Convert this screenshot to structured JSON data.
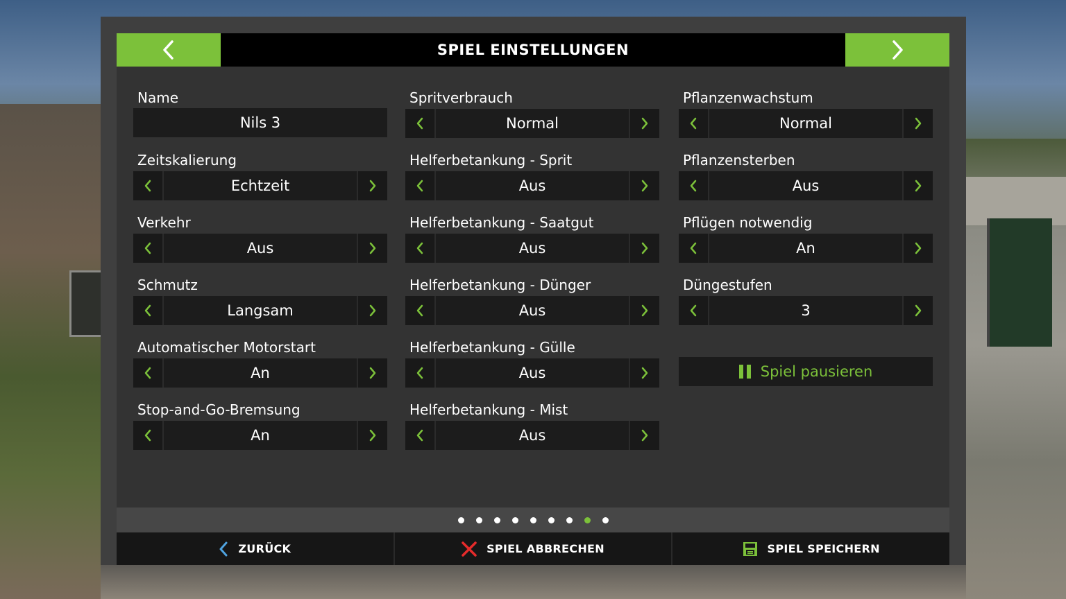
{
  "colors": {
    "accent": "#7cc13a",
    "cancel_red": "#e52b2b",
    "back_blue": "#4fa3e0"
  },
  "header": {
    "title": "SPIEL EINSTELLUNGEN",
    "prev_icon": "chevron-left-icon",
    "next_icon": "chevron-right-icon"
  },
  "settings": {
    "col1": [
      {
        "label": "Name",
        "value": "Nils 3",
        "type": "text"
      },
      {
        "label": "Zeitskalierung",
        "value": "Echtzeit"
      },
      {
        "label": "Verkehr",
        "value": "Aus"
      },
      {
        "label": "Schmutz",
        "value": "Langsam"
      },
      {
        "label": "Automatischer Motorstart",
        "value": "An"
      },
      {
        "label": "Stop-and-Go-Bremsung",
        "value": "An"
      }
    ],
    "col2": [
      {
        "label": "Spritverbrauch",
        "value": "Normal"
      },
      {
        "label": "Helferbetankung - Sprit",
        "value": "Aus"
      },
      {
        "label": "Helferbetankung - Saatgut",
        "value": "Aus"
      },
      {
        "label": "Helferbetankung - Dünger",
        "value": "Aus"
      },
      {
        "label": "Helferbetankung - Gülle",
        "value": "Aus"
      },
      {
        "label": "Helferbetankung - Mist",
        "value": "Aus"
      }
    ],
    "col3": [
      {
        "label": "Pflanzenwachstum",
        "value": "Normal"
      },
      {
        "label": "Pflanzensterben",
        "value": "Aus"
      },
      {
        "label": "Pflügen notwendig",
        "value": "An"
      },
      {
        "label": "Düngestufen",
        "value": "3"
      }
    ]
  },
  "pause_button": {
    "label": "Spiel pausieren",
    "icon": "pause-icon"
  },
  "pager": {
    "count": 9,
    "active_index": 7
  },
  "footer": {
    "back": {
      "label": "ZURÜCK",
      "icon": "chevron-left-icon"
    },
    "cancel": {
      "label": "SPIEL ABBRECHEN",
      "icon": "close-icon"
    },
    "save": {
      "label": "SPIEL SPEICHERN",
      "icon": "save-icon"
    }
  }
}
